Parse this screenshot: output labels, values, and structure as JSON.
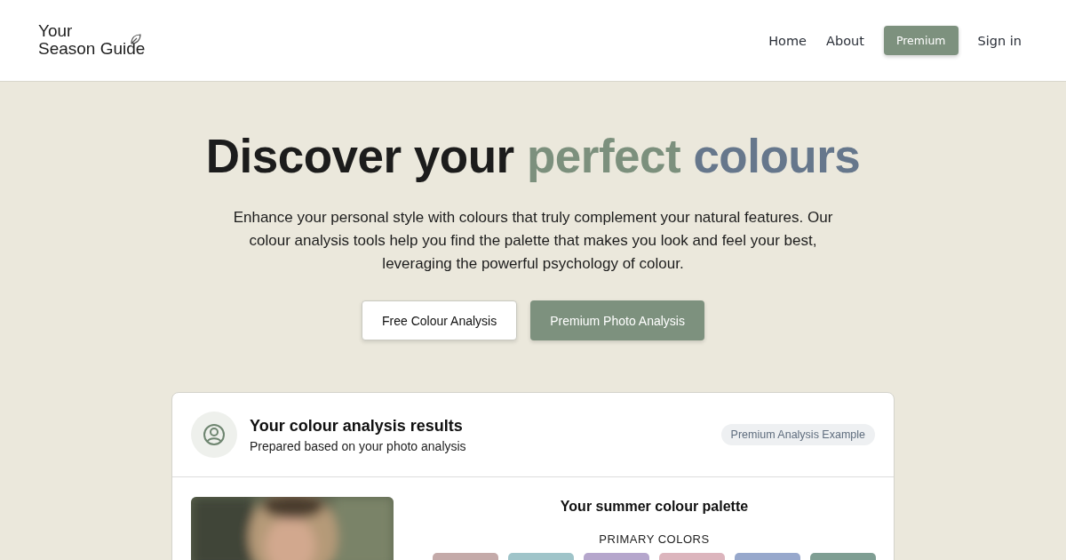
{
  "header": {
    "logo": [
      "Your",
      "Season Guide"
    ],
    "nav": [
      {
        "label": "Home",
        "kind": "link"
      },
      {
        "label": "About",
        "kind": "link"
      },
      {
        "label": "Premium",
        "kind": "button"
      },
      {
        "label": "Sign in",
        "kind": "link"
      }
    ]
  },
  "hero": {
    "title": [
      {
        "text": "Discover your",
        "color": "#1c1c1c"
      },
      {
        "text": "perfect",
        "color": "#7c907d"
      },
      {
        "text": "colours",
        "color": "#66778c"
      }
    ],
    "text": "Enhance your personal style with colours that truly complement your natural features. Our colour analysis tools help you find the palette that makes you look and feel your best, leveraging the powerful psychology of colour.",
    "buttons": [
      {
        "label": "Free Colour Analysis",
        "kind": "secondary"
      },
      {
        "label": "Premium Photo Analysis",
        "kind": "primary"
      }
    ]
  },
  "results": {
    "title": "Your colour analysis results",
    "subtitle": "Prepared based on your photo analysis",
    "badge": "Premium Analysis Example",
    "palette_title": "Your summer colour palette",
    "section": "PRIMARY COLORS",
    "swatches": [
      {
        "color": "#c4aaa9"
      },
      {
        "color": "#9fc4c9"
      },
      {
        "color": "#b5a6cc"
      },
      {
        "color": "#dcb5bd"
      },
      {
        "color": "#97a8cc"
      },
      {
        "color": "#7f9e93"
      }
    ]
  }
}
